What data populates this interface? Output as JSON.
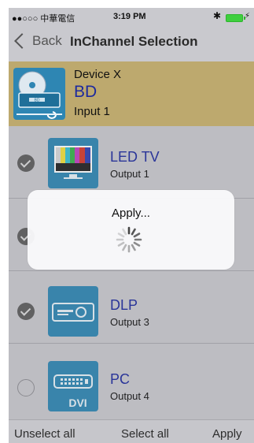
{
  "status_bar": {
    "carrier": "●●○○○ 中華電信",
    "time": "3:19 PM"
  },
  "nav": {
    "back_label": "Back",
    "title": "InChannel Selection"
  },
  "source": {
    "device": "Device X",
    "name": "BD",
    "input": "Input 1",
    "icon_label": "BD"
  },
  "outputs": [
    {
      "name": "LED TV",
      "port": "Output 1",
      "checked": true,
      "icon": "tv-icon"
    },
    {
      "name": "",
      "port": "",
      "checked": true,
      "icon": ""
    },
    {
      "name": "DLP",
      "port": "Output 3",
      "checked": true,
      "icon": "projector-icon"
    },
    {
      "name": "PC",
      "port": "Output 4",
      "checked": false,
      "icon": "dvi-icon",
      "icon_label": "DVI"
    }
  ],
  "toolbar": {
    "unselect_all": "Unselect all",
    "select_all": "Select all",
    "apply": "Apply"
  },
  "dialog": {
    "title": "Apply..."
  },
  "colors": {
    "source_bg": "#bda96e",
    "icon_blue": "#2e86b3",
    "name_text": "#1d2a9e"
  }
}
